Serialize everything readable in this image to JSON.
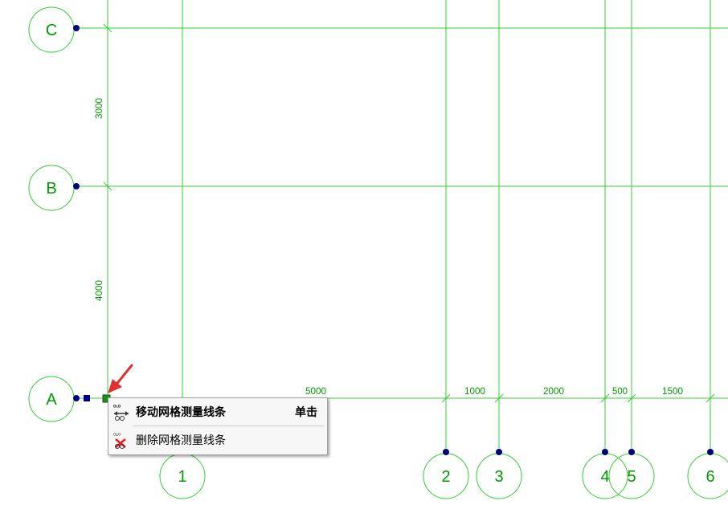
{
  "grid": {
    "rows": [
      {
        "label": "C"
      },
      {
        "label": "B"
      },
      {
        "label": "A"
      }
    ],
    "columns": [
      {
        "label": "1"
      },
      {
        "label": "2"
      },
      {
        "label": "3"
      },
      {
        "label": "4"
      },
      {
        "label": "5"
      },
      {
        "label": "6"
      }
    ],
    "horizontal_dimensions": [
      "5000",
      "1000",
      "2000",
      "500",
      "1500"
    ],
    "vertical_dimensions": [
      "3000",
      "4000"
    ],
    "colors": {
      "grid_line": "#33cc33",
      "bubble": "#33cc33",
      "grip_point": "#000080",
      "active_grip": "#1e8c1e",
      "arrow": "#e03030"
    }
  },
  "context_menu": {
    "items": [
      {
        "label": "移动网格测量线条",
        "shortcut": "单击",
        "icon": "move-grid-icon"
      },
      {
        "label": "删除网格测量线条",
        "icon": "delete-grid-icon"
      }
    ]
  }
}
